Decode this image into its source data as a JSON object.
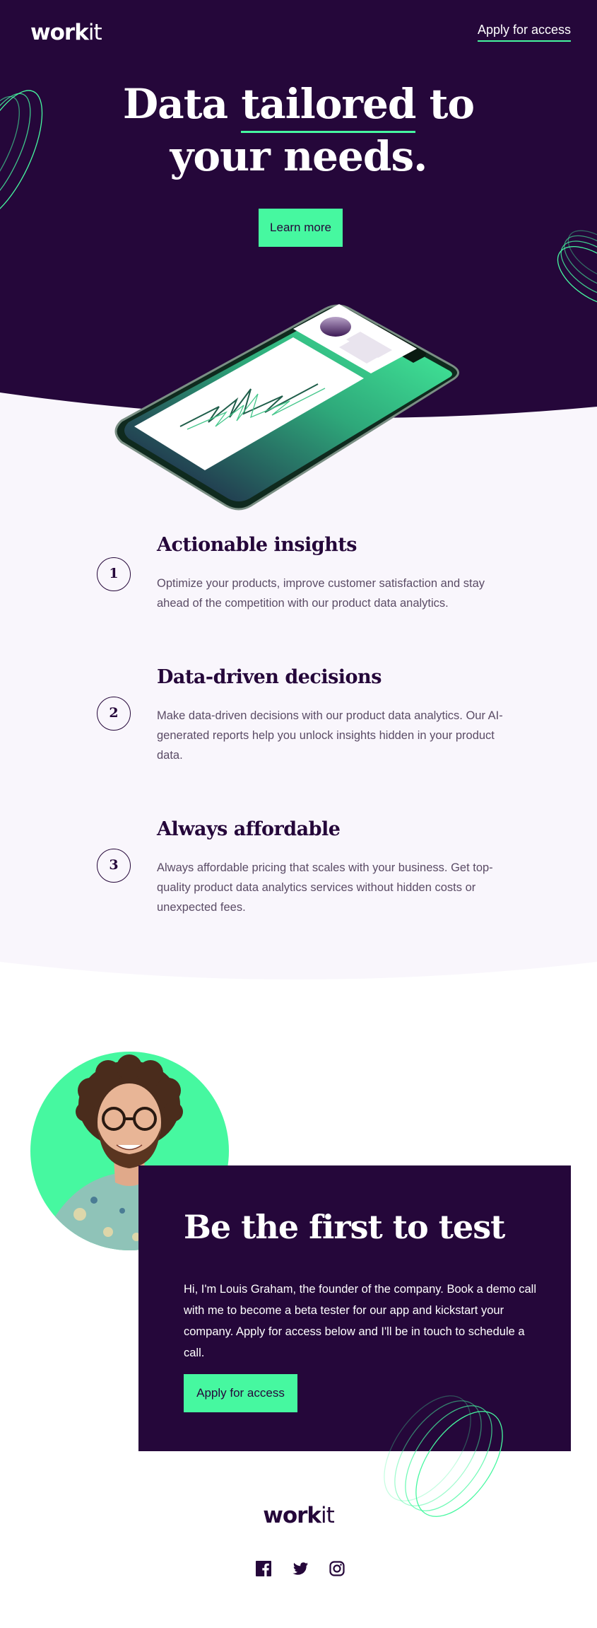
{
  "header": {
    "logo_bold": "work",
    "logo_light": "it",
    "apply_link": "Apply for access"
  },
  "hero": {
    "title_line1_part1": "Data ",
    "title_line1_underlined": "tailored",
    "title_line1_part2": " to",
    "title_line2": "your needs.",
    "cta_label": "Learn more"
  },
  "features": {
    "items": [
      {
        "number": "1",
        "title": "Actionable insights",
        "text": "Optimize your products, improve customer satisfaction and stay ahead of the competition with our product data analytics."
      },
      {
        "number": "2",
        "title": "Data-driven decisions",
        "text": "Make data-driven decisions with our product data analytics. Our AI-generated reports help you unlock insights hidden in your product data."
      },
      {
        "number": "3",
        "title": "Always affordable",
        "text": "Always affordable pricing that scales with your business. Get top-quality product data analytics services without hidden costs or unexpected fees."
      }
    ]
  },
  "tester": {
    "title": "Be the first to test",
    "text": "Hi, I'm Louis Graham, the founder of the company. Book a demo call with me to become a beta tester for our app and kickstart your company. Apply for access below and I'll be in touch to schedule a call.",
    "cta_label": "Apply for access"
  },
  "footer": {
    "logo_bold": "work",
    "logo_light": "it",
    "socials": [
      {
        "icon": "facebook-icon"
      },
      {
        "icon": "twitter-icon"
      },
      {
        "icon": "instagram-icon"
      }
    ]
  },
  "colors": {
    "dark_purple": "#25073a",
    "mint": "#46f8a0",
    "light_bg": "#f9f6fc"
  }
}
